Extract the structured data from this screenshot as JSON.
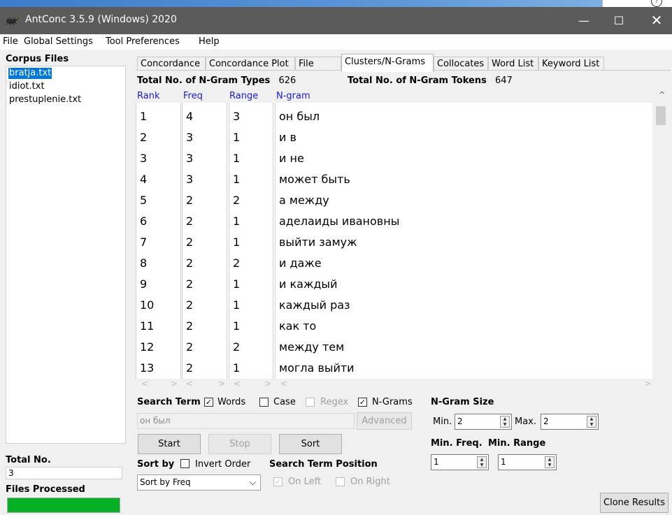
{
  "window": {
    "title": "AntConc 3.5.9 (Windows) 2020",
    "minimize_glyph": "—",
    "maximize_glyph": "☐",
    "close_glyph": "✕",
    "desktop_glyph": "?"
  },
  "menu": [
    "File",
    "Global Settings",
    "Tool Preferences",
    "Help"
  ],
  "corpus": {
    "label": "Corpus Files",
    "files": [
      "bratja.txt",
      "idiot.txt",
      "prestuplenie.txt"
    ],
    "total_label": "Total No.",
    "total_value": "3",
    "files_processed_label": "Files Processed",
    "progress_fraction": 1.0
  },
  "tabs": [
    "Concordance",
    "Concordance Plot",
    "File View",
    "Clusters/N-Grams",
    "Collocates",
    "Word List",
    "Keyword List"
  ],
  "active_tab": "Clusters/N-Grams",
  "stats": {
    "types_label": "Total No. of N-Gram Types",
    "types_value": "626",
    "tokens_label": "Total No. of N-Gram Tokens",
    "tokens_value": "647"
  },
  "columns": [
    "Rank",
    "Freq",
    "Range",
    "N-gram"
  ],
  "rows": [
    {
      "rank": "1",
      "freq": "4",
      "range": "3",
      "ngram": "он был"
    },
    {
      "rank": "2",
      "freq": "3",
      "range": "1",
      "ngram": "и в"
    },
    {
      "rank": "3",
      "freq": "3",
      "range": "1",
      "ngram": "и не"
    },
    {
      "rank": "4",
      "freq": "3",
      "range": "1",
      "ngram": "может быть"
    },
    {
      "rank": "5",
      "freq": "2",
      "range": "2",
      "ngram": "а между"
    },
    {
      "rank": "6",
      "freq": "2",
      "range": "1",
      "ngram": "аделаиды ивановны"
    },
    {
      "rank": "7",
      "freq": "2",
      "range": "1",
      "ngram": "выйти замуж"
    },
    {
      "rank": "8",
      "freq": "2",
      "range": "2",
      "ngram": "и даже"
    },
    {
      "rank": "9",
      "freq": "2",
      "range": "1",
      "ngram": "и каждый"
    },
    {
      "rank": "10",
      "freq": "2",
      "range": "1",
      "ngram": "каждый раз"
    },
    {
      "rank": "11",
      "freq": "2",
      "range": "1",
      "ngram": "как то"
    },
    {
      "rank": "12",
      "freq": "2",
      "range": "2",
      "ngram": "между тем"
    },
    {
      "rank": "13",
      "freq": "2",
      "range": "1",
      "ngram": "могла выйти"
    }
  ],
  "search": {
    "label": "Search Term",
    "words_label": "Words",
    "words_checked": true,
    "case_label": "Case",
    "case_checked": false,
    "regex_label": "Regex",
    "regex_checked": false,
    "ngrams_label": "N-Grams",
    "ngrams_checked": true,
    "value": "он был",
    "advanced_label": "Advanced",
    "start_label": "Start",
    "stop_label": "Stop",
    "sort_label": "Sort"
  },
  "ngram_size": {
    "label": "N-Gram Size",
    "min_label": "Min.",
    "min_value": "2",
    "max_label": "Max.",
    "max_value": "2",
    "min_freq_label": "Min. Freq.",
    "min_freq_value": "1",
    "min_range_label": "Min. Range",
    "min_range_value": "1"
  },
  "sort": {
    "label": "Sort by",
    "invert_label": "Invert Order",
    "invert_checked": false,
    "selected": "Sort by Freq"
  },
  "position": {
    "label": "Search Term Position",
    "on_left_label": "On Left",
    "on_left_checked": true,
    "on_right_label": "On Right",
    "on_right_checked": false
  },
  "clone_label": "Clone Results",
  "colors": {
    "titlebar": "#5b5b5b",
    "header_blue": "#1a1ad1",
    "selection": "#0078d7",
    "progress": "#06b025"
  }
}
